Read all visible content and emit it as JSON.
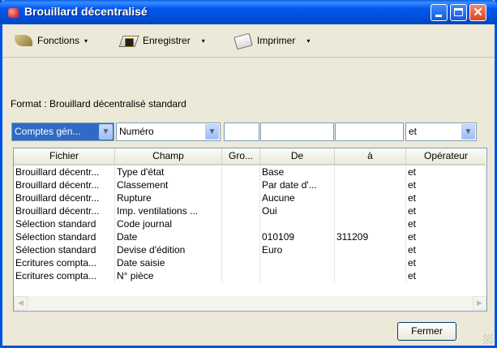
{
  "window": {
    "title": "Brouillard décentralisé",
    "colors": {
      "titlebar": "#0058ee",
      "selection": "#316ac5"
    }
  },
  "toolbar": {
    "functions_label": "Fonctions",
    "save_label": "Enregistrer",
    "print_label": "Imprimer"
  },
  "format_label": "Format : Brouillard décentralisé standard",
  "filters": {
    "fichier": "Comptes gén...",
    "champ": "Numéro",
    "gro": "",
    "de": "",
    "a": "",
    "operateur": "et"
  },
  "columns": [
    "Fichier",
    "Champ",
    "Gro...",
    "De",
    "à",
    "Opérateur"
  ],
  "rows": [
    {
      "fichier": "Brouillard décentr...",
      "champ": "Type d'état",
      "gro": "",
      "de": "Base",
      "a": "",
      "op": "et"
    },
    {
      "fichier": "Brouillard décentr...",
      "champ": "Classement",
      "gro": "",
      "de": "Par date d'...",
      "a": "",
      "op": "et"
    },
    {
      "fichier": "Brouillard décentr...",
      "champ": "Rupture",
      "gro": "",
      "de": "Aucune",
      "a": "",
      "op": "et"
    },
    {
      "fichier": "Brouillard décentr...",
      "champ": "Imp. ventilations ...",
      "gro": "",
      "de": "Oui",
      "a": "",
      "op": "et"
    },
    {
      "fichier": "Sélection standard",
      "champ": "Code journal",
      "gro": "",
      "de": "",
      "a": "",
      "op": "et"
    },
    {
      "fichier": "Sélection standard",
      "champ": "Date",
      "gro": "",
      "de": "010109",
      "a": "311209",
      "op": "et"
    },
    {
      "fichier": "Sélection standard",
      "champ": "Devise d'édition",
      "gro": "",
      "de": "Euro",
      "a": "",
      "op": "et"
    },
    {
      "fichier": "Ecritures compta...",
      "champ": "Date saisie",
      "gro": "",
      "de": "",
      "a": "",
      "op": "et"
    },
    {
      "fichier": "Ecritures compta...",
      "champ": "N° pièce",
      "gro": "",
      "de": "",
      "a": "",
      "op": "et"
    }
  ],
  "buttons": {
    "close_label": "Fermer"
  },
  "icons": {
    "min": "minimize-icon",
    "max": "maximize-icon",
    "close": "close-icon",
    "close_glyph": "✕",
    "dropdown_glyph": "▾",
    "combo_glyph": "▼",
    "up": "▲",
    "down": "▼",
    "left": "◀",
    "right": "▶"
  }
}
